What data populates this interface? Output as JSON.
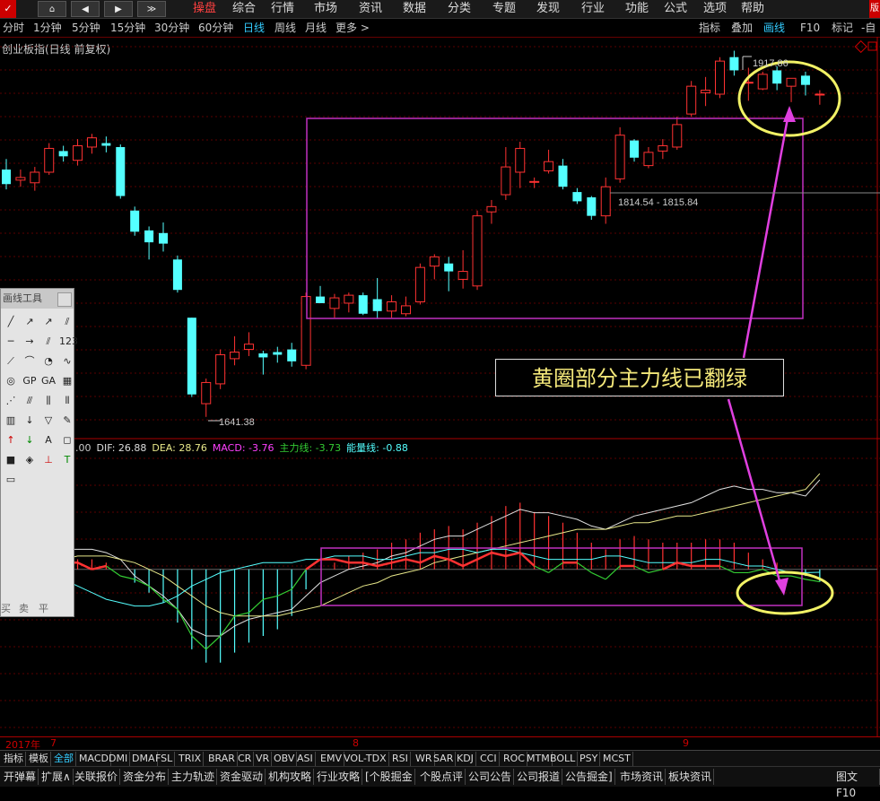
{
  "topbar": {
    "logo": "✓",
    "nav_buttons": [
      "⌂",
      "◀",
      "▶",
      "≫"
    ],
    "menus": [
      "操盘",
      "综合",
      "行情",
      "市场",
      "资讯",
      "数据",
      "分类",
      "专题",
      "发现",
      "行业",
      "功能",
      "公式",
      "选项",
      "帮助"
    ],
    "active_menu": "操盘",
    "right_badge": "版"
  },
  "periods": {
    "items": [
      "分时",
      "1分钟",
      "5分钟",
      "15分钟",
      "30分钟",
      "60分钟",
      "日线",
      "周线",
      "月线",
      "更多 >"
    ],
    "active": "日线"
  },
  "right_tools": {
    "items": [
      "指标",
      "叠加",
      "画线",
      "F10",
      "标记",
      "-自"
    ],
    "active": "画线"
  },
  "index_title": "创业板指(日线 前复权)",
  "annotation_text": "黄圈部分主力线已翻绿",
  "price_labels": {
    "high": "1917.86",
    "low": "1641.38",
    "cursor": "1814.54 - 1815.84"
  },
  "macd_legend": {
    "prefix": ".00",
    "dif": "DIF: 26.88",
    "dea": "DEA: 28.76",
    "macd": "MACD: -3.76",
    "main": "主力线: -3.73",
    "energy": "能量线: -0.88"
  },
  "colors": {
    "up": "#ff3232",
    "down": "#54ffff",
    "dif": "#e0e0e0",
    "dea": "#e8e88a",
    "macd": "#ff40ff",
    "main": "#33cc33",
    "energy": "#54ffff",
    "box": "#c030c0",
    "circle": "#f2f266"
  },
  "drawtool": {
    "title": "画线工具",
    "icons": [
      "line-icon",
      "ray-icon",
      "arrow-icon",
      "parallel-icon",
      "segment-icon",
      "arrow-line-icon",
      "channel-icon",
      "fib-icon",
      "cycle-icon",
      "arc-icon",
      "circle-icon",
      "wave-icon",
      "gann-icon",
      "gp-icon",
      "ga-icon",
      "bars-icon",
      "fan-icon",
      "speed-icon",
      "pitchfork-icon",
      "time-icon",
      "box-icon",
      "down-arrow-icon",
      "triangle-icon",
      "pencil-icon",
      "up-arrow-icon",
      "down-green-arrow-icon",
      "text-icon",
      "eraser-icon",
      "square-icon",
      "color-icon",
      "buy-icon",
      "sell-icon",
      "level-icon"
    ],
    "bottom": [
      "买",
      "卖",
      "平"
    ],
    "text_glyphs": [
      "123",
      "GP",
      "GA",
      "G",
      "A"
    ]
  },
  "date_labels": [
    "2017年",
    "7",
    "8",
    "9"
  ],
  "tabs1": [
    "指标",
    "模板",
    "全部",
    "MACD",
    "DMI",
    "DMA",
    "FSL",
    "TRIX",
    "BRAR",
    "CR",
    "VR",
    "OBV",
    "ASI",
    "EMV",
    "VOL-TDX",
    "RSI",
    "WR",
    "SAR",
    "KDJ",
    "CCI",
    "ROC",
    "MTM",
    "BOLL",
    "PSY",
    "MCST"
  ],
  "tabs1_active": "全部",
  "tabs2": [
    "开弹幕",
    "扩展∧",
    "关联报价",
    "资金分布",
    "主力轨迹",
    "资金驱动",
    "机构攻略",
    "行业攻略",
    "[个股掘金",
    "个股点评",
    "公司公告",
    "公司报道",
    "公告掘金]",
    "市场资讯",
    "板块资讯"
  ],
  "tabs2_right": "图文F10",
  "chart_data": {
    "type": "candlestick",
    "title": "创业板指(日线 前复权)",
    "candles": [
      {
        "o": 1828,
        "h": 1836,
        "l": 1813,
        "c": 1817
      },
      {
        "o": 1820,
        "h": 1828,
        "l": 1815,
        "c": 1822
      },
      {
        "o": 1818,
        "h": 1830,
        "l": 1812,
        "c": 1826
      },
      {
        "o": 1826,
        "h": 1848,
        "l": 1824,
        "c": 1844
      },
      {
        "o": 1842,
        "h": 1846,
        "l": 1834,
        "c": 1838
      },
      {
        "o": 1835,
        "h": 1851,
        "l": 1831,
        "c": 1846
      },
      {
        "o": 1845,
        "h": 1855,
        "l": 1840,
        "c": 1852
      },
      {
        "o": 1848,
        "h": 1853,
        "l": 1841,
        "c": 1846
      },
      {
        "o": 1845,
        "h": 1847,
        "l": 1806,
        "c": 1808
      },
      {
        "o": 1797,
        "h": 1800,
        "l": 1778,
        "c": 1781
      },
      {
        "o": 1782,
        "h": 1785,
        "l": 1760,
        "c": 1773
      },
      {
        "o": 1780,
        "h": 1788,
        "l": 1766,
        "c": 1772
      },
      {
        "o": 1760,
        "h": 1763,
        "l": 1735,
        "c": 1737
      },
      {
        "o": 1716,
        "h": 1716,
        "l": 1656,
        "c": 1658
      },
      {
        "o": 1651,
        "h": 1670,
        "l": 1641,
        "c": 1667
      },
      {
        "o": 1666,
        "h": 1692,
        "l": 1662,
        "c": 1688
      },
      {
        "o": 1685,
        "h": 1702,
        "l": 1680,
        "c": 1690
      },
      {
        "o": 1692,
        "h": 1705,
        "l": 1687,
        "c": 1696
      },
      {
        "o": 1689,
        "h": 1691,
        "l": 1673,
        "c": 1686
      },
      {
        "o": 1690,
        "h": 1694,
        "l": 1682,
        "c": 1688
      },
      {
        "o": 1692,
        "h": 1697,
        "l": 1679,
        "c": 1683
      },
      {
        "o": 1680,
        "h": 1735,
        "l": 1677,
        "c": 1732
      },
      {
        "o": 1732,
        "h": 1740,
        "l": 1727,
        "c": 1727
      },
      {
        "o": 1723,
        "h": 1734,
        "l": 1716,
        "c": 1731
      },
      {
        "o": 1727,
        "h": 1735,
        "l": 1720,
        "c": 1733
      },
      {
        "o": 1733,
        "h": 1735,
        "l": 1718,
        "c": 1719
      },
      {
        "o": 1730,
        "h": 1746,
        "l": 1715,
        "c": 1721
      },
      {
        "o": 1721,
        "h": 1733,
        "l": 1716,
        "c": 1728
      },
      {
        "o": 1719,
        "h": 1732,
        "l": 1717,
        "c": 1725
      },
      {
        "o": 1728,
        "h": 1757,
        "l": 1726,
        "c": 1754
      },
      {
        "o": 1755,
        "h": 1764,
        "l": 1745,
        "c": 1762
      },
      {
        "o": 1757,
        "h": 1762,
        "l": 1736,
        "c": 1751
      },
      {
        "o": 1745,
        "h": 1767,
        "l": 1738,
        "c": 1751
      },
      {
        "o": 1740,
        "h": 1797,
        "l": 1737,
        "c": 1793
      },
      {
        "o": 1796,
        "h": 1805,
        "l": 1787,
        "c": 1800
      },
      {
        "o": 1809,
        "h": 1845,
        "l": 1805,
        "c": 1830
      },
      {
        "o": 1826,
        "h": 1849,
        "l": 1814,
        "c": 1844
      },
      {
        "o": 1819,
        "h": 1822,
        "l": 1814,
        "c": 1819
      },
      {
        "o": 1827,
        "h": 1843,
        "l": 1825,
        "c": 1834
      },
      {
        "o": 1831,
        "h": 1836,
        "l": 1813,
        "c": 1815
      },
      {
        "o": 1811,
        "h": 1814,
        "l": 1802,
        "c": 1804
      },
      {
        "o": 1807,
        "h": 1808,
        "l": 1790,
        "c": 1793
      },
      {
        "o": 1793,
        "h": 1822,
        "l": 1787,
        "c": 1815
      },
      {
        "o": 1821,
        "h": 1860,
        "l": 1818,
        "c": 1854
      },
      {
        "o": 1850,
        "h": 1851,
        "l": 1834,
        "c": 1837
      },
      {
        "o": 1831,
        "h": 1845,
        "l": 1829,
        "c": 1841
      },
      {
        "o": 1842,
        "h": 1851,
        "l": 1836,
        "c": 1846
      },
      {
        "o": 1845,
        "h": 1868,
        "l": 1843,
        "c": 1862
      },
      {
        "o": 1870,
        "h": 1895,
        "l": 1868,
        "c": 1891
      },
      {
        "o": 1886,
        "h": 1898,
        "l": 1876,
        "c": 1888
      },
      {
        "o": 1885,
        "h": 1913,
        "l": 1882,
        "c": 1910
      },
      {
        "o": 1913,
        "h": 1917.86,
        "l": 1899,
        "c": 1903
      },
      {
        "o": 1894,
        "h": 1905,
        "l": 1880,
        "c": 1894
      },
      {
        "o": 1889,
        "h": 1902,
        "l": 1888,
        "c": 1900
      },
      {
        "o": 1903,
        "h": 1906,
        "l": 1888,
        "c": 1893
      },
      {
        "o": 1891,
        "h": 1896,
        "l": 1879,
        "c": 1897
      },
      {
        "o": 1899,
        "h": 1902,
        "l": 1884,
        "c": 1892
      },
      {
        "o": 1885,
        "h": 1888,
        "l": 1877,
        "c": 1885
      }
    ],
    "price_range": [
      1630,
      1925
    ],
    "macd_range": [
      -48,
      36
    ],
    "macd": {
      "hist": [
        1,
        1,
        2,
        2,
        3,
        3,
        3,
        2,
        0,
        -4,
        -7,
        -10,
        -16,
        -24,
        -28,
        -28,
        -25,
        -22,
        -20,
        -18,
        -14,
        -6,
        0,
        2,
        4,
        5,
        6,
        8,
        9,
        11,
        12,
        13,
        12,
        14,
        16,
        19,
        20,
        17,
        16,
        14,
        11,
        8,
        6,
        9,
        10,
        9,
        8,
        8,
        8,
        9,
        9,
        8,
        5,
        3,
        2,
        0,
        -2,
        -3.76
      ],
      "dif": [
        2,
        3,
        4,
        5,
        6,
        6,
        6,
        5,
        3,
        -2,
        -5,
        -8,
        -12,
        -18,
        -20,
        -20,
        -17,
        -15,
        -14,
        -13,
        -12,
        -8,
        -4,
        -2,
        0,
        1,
        2,
        4,
        5,
        7,
        9,
        10,
        10,
        12,
        14,
        16,
        18,
        17,
        17,
        16,
        15,
        13,
        12,
        14,
        16,
        17,
        18,
        19,
        20,
        22,
        24,
        25,
        24,
        24,
        23,
        23,
        22,
        26.88
      ],
      "dea": [
        1,
        2,
        2,
        3,
        3,
        4,
        4,
        4,
        3,
        2,
        0,
        -2,
        -5,
        -8,
        -11,
        -13,
        -14,
        -14,
        -14,
        -14,
        -13,
        -12,
        -11,
        -9,
        -7,
        -5,
        -4,
        -2,
        -1,
        0,
        2,
        3,
        4,
        5,
        6,
        7,
        8,
        9,
        10,
        11,
        12,
        12,
        12,
        13,
        14,
        14,
        15,
        16,
        16,
        17,
        18,
        19,
        20,
        21,
        22,
        23,
        24,
        28.76
      ],
      "main": [
        3,
        2,
        3,
        1,
        2,
        2,
        0,
        1,
        -2,
        -3,
        -5,
        -9,
        -12,
        -20,
        -24,
        -20,
        -14,
        -13,
        -9,
        -8,
        -6,
        0,
        3,
        3,
        2,
        2,
        1,
        2,
        3,
        2,
        4,
        3,
        1,
        3,
        5,
        4,
        5,
        1,
        -1,
        2,
        2,
        -1,
        -3,
        1,
        1,
        -1,
        0,
        2,
        1,
        1,
        1,
        -1,
        -1,
        0,
        -2,
        -2,
        -3,
        -3.73
      ],
      "energy": [
        -1,
        0,
        -1,
        -2,
        -3,
        -5,
        -7,
        -9,
        -10,
        -11,
        -11,
        -10,
        -8,
        -5,
        -3,
        -1,
        0,
        1,
        2,
        2,
        2,
        3,
        3,
        4,
        4,
        4,
        3,
        3,
        4,
        5,
        5,
        6,
        6,
        5,
        6,
        6,
        5,
        4,
        3,
        3,
        3,
        3,
        4,
        4,
        3,
        2,
        2,
        2,
        2,
        3,
        3,
        2,
        1,
        1,
        0,
        -1,
        -1,
        -0.88
      ]
    }
  }
}
